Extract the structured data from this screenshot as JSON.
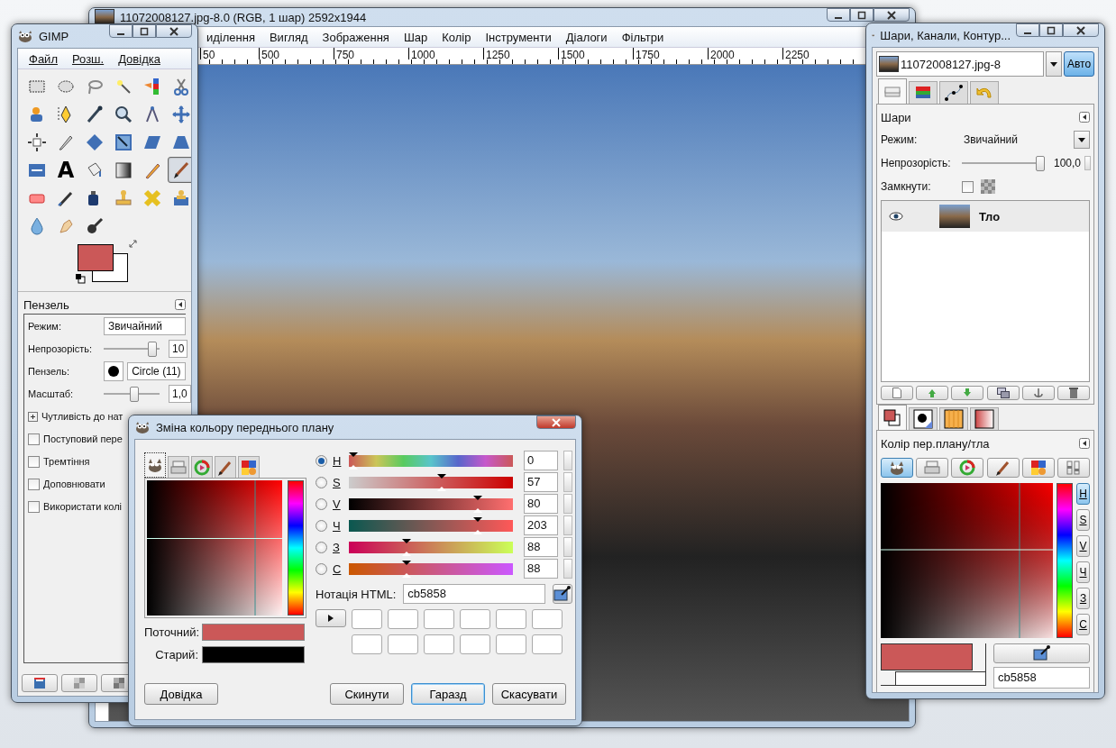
{
  "image_window": {
    "title": "11072008127.jpg-8.0 (RGB, 1 шар) 2592x1944",
    "menu": [
      "иділення",
      "Вигляд",
      "Зображення",
      "Шар",
      "Колір",
      "Інструменти",
      "Діалоги",
      "Фільтри"
    ],
    "ruler_labels": [
      "50",
      "500",
      "750",
      "1000",
      "1250",
      "1500",
      "1750",
      "2000",
      "2250"
    ]
  },
  "toolbox": {
    "title": "GIMP",
    "menu": [
      "Файл",
      "Розш.",
      "Довідка"
    ],
    "tools": [
      {
        "selected": false
      },
      {
        "selected": false
      },
      {
        "selected": false
      },
      {
        "selected": false
      },
      {
        "selected": false
      },
      {
        "selected": false
      },
      {
        "selected": false
      },
      {
        "selected": false
      },
      {
        "selected": false
      },
      {
        "selected": false
      },
      {
        "selected": false
      },
      {
        "selected": false
      },
      {
        "selected": false
      },
      {
        "selected": false
      },
      {
        "selected": false
      },
      {
        "selected": false
      },
      {
        "selected": false
      },
      {
        "selected": false
      },
      {
        "selected": false
      },
      {
        "selected": false,
        "glyph": "A"
      },
      {
        "selected": false
      },
      {
        "selected": false
      },
      {
        "selected": false
      },
      {
        "selected": true
      },
      {
        "selected": false
      },
      {
        "selected": false
      },
      {
        "selected": false
      },
      {
        "selected": false
      },
      {
        "selected": false
      },
      {
        "selected": false
      },
      {
        "selected": false
      },
      {
        "selected": false
      },
      {
        "selected": false
      }
    ],
    "swatches": [
      {
        "kind": "foreground",
        "color": "#cb5858"
      },
      {
        "kind": "background",
        "color": "#ffffff"
      }
    ],
    "options": {
      "title": "Пензель",
      "mode_label": "Режим:",
      "mode": "Звичайний",
      "opacity": {
        "label": "Непрозорість:",
        "level": 0.95,
        "value": "10"
      },
      "brush_label": "Пензель:",
      "brush": "Circle (11)",
      "scale": {
        "label": "Масштаб:",
        "level": 0.55,
        "value": "1,0"
      },
      "expander": "Чутливість до нат",
      "checks": [
        {
          "label": "Поступовий пере",
          "checked": false
        },
        {
          "label": "Тремтіння",
          "checked": false
        },
        {
          "label": "Доповнювати",
          "checked": false
        },
        {
          "label": "Використати колі",
          "checked": false
        }
      ]
    }
  },
  "dock": {
    "title": "Шари, Канали, Контур...",
    "image": "11072008127.jpg-8",
    "auto": "Авто",
    "tabs": [
      {
        "selected": true
      },
      {
        "selected": false
      },
      {
        "selected": false
      },
      {
        "selected": false
      }
    ],
    "layers_title": "Шари",
    "mode_label": "Режим:",
    "mode": "Звичайний",
    "opacity": {
      "label": "Непрозорість:",
      "level": 1,
      "value": "100,0"
    },
    "lock_label": "Замкнути:",
    "lock_checked": false,
    "layers": [
      {
        "name": "Тло",
        "visible": true,
        "selected": true
      }
    ],
    "color_tabs": [
      {
        "selected": true
      },
      {
        "selected": false
      },
      {
        "selected": false
      },
      {
        "selected": false
      }
    ],
    "color_title": "Колір пер.плану/тла",
    "selectors": [
      {
        "selected": true
      },
      {
        "selected": false
      },
      {
        "selected": false
      },
      {
        "selected": false
      },
      {
        "selected": false
      },
      {
        "selected": false
      }
    ],
    "channel_buttons": [
      {
        "label": "H",
        "selected": true
      },
      {
        "label": "S",
        "selected": false
      },
      {
        "label": "V",
        "selected": false
      },
      {
        "label": "Ч",
        "selected": false
      },
      {
        "label": "З",
        "selected": false
      },
      {
        "label": "С",
        "selected": false
      }
    ],
    "swatches": [
      {
        "kind": "foreground",
        "color": "#cb5858"
      },
      {
        "kind": "background",
        "color": "#ffffff"
      }
    ],
    "hex": "cb5858"
  },
  "color_dialog": {
    "title": "Зміна кольору переднього плану",
    "tabs": [
      {
        "selected": true
      },
      {
        "selected": false
      },
      {
        "selected": false
      },
      {
        "selected": false
      },
      {
        "selected": false
      }
    ],
    "swatches": [
      {
        "label": "Поточний:",
        "color": "#cb5858"
      },
      {
        "label": "Старий:",
        "color": "#000000"
      }
    ],
    "channels": [
      {
        "label": "H",
        "selected": true,
        "level": 0,
        "value": "0"
      },
      {
        "label": "S",
        "selected": false,
        "level": 0.57,
        "value": "57"
      },
      {
        "label": "V",
        "selected": false,
        "level": 0.8,
        "value": "80"
      },
      {
        "label": "Ч",
        "selected": false,
        "level": 0.8,
        "value": "203"
      },
      {
        "label": "З",
        "selected": false,
        "level": 0.345,
        "value": "88"
      },
      {
        "label": "С",
        "selected": false,
        "level": 0.345,
        "value": "88"
      }
    ],
    "html_label": "Нотація HTML:",
    "html_value": "cb5858",
    "buttons": [
      {
        "label": "Довідка",
        "default": false
      },
      {
        "label": "Скинути",
        "default": false
      },
      {
        "label": "Гаразд",
        "default": true
      },
      {
        "label": "Скасувати",
        "default": false
      }
    ]
  }
}
